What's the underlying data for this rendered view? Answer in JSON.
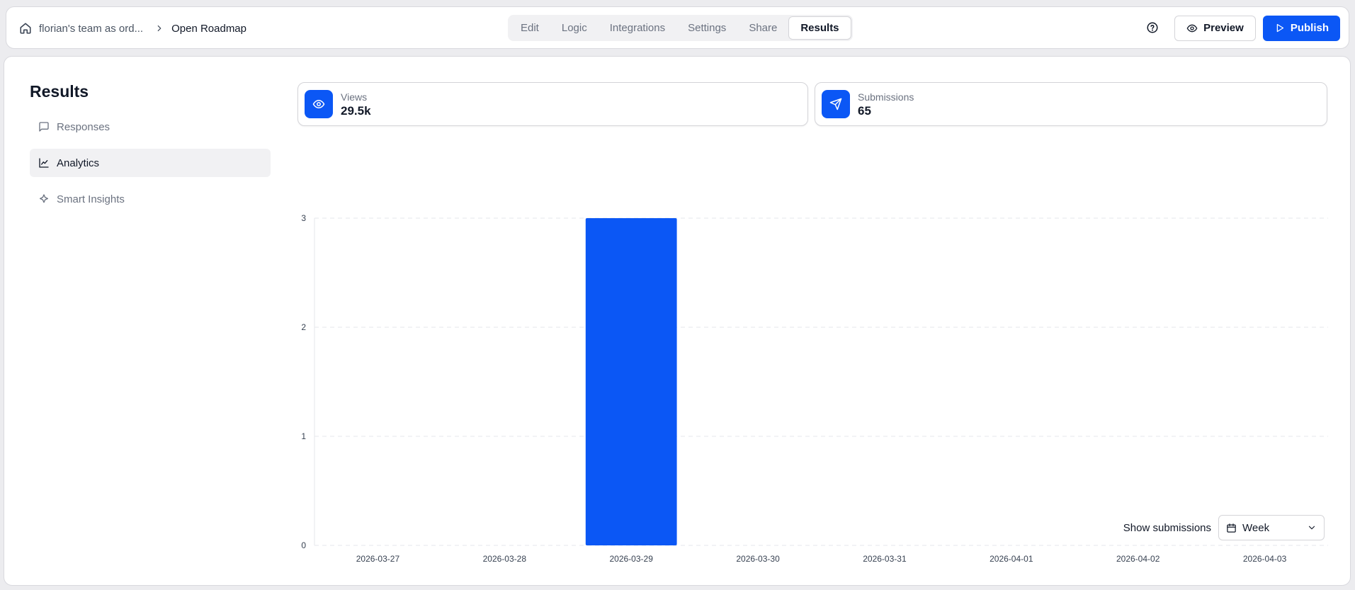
{
  "breadcrumb": {
    "team": "florian's team as ord...",
    "form": "Open Roadmap"
  },
  "tabs": [
    "Edit",
    "Logic",
    "Integrations",
    "Settings",
    "Share",
    "Results"
  ],
  "active_tab": "Results",
  "actions": {
    "preview": "Preview",
    "publish": "Publish"
  },
  "sidebar": {
    "title": "Results",
    "items": [
      {
        "label": "Responses",
        "icon": "message-square-icon",
        "active": false
      },
      {
        "label": "Analytics",
        "icon": "line-chart-icon",
        "active": true
      },
      {
        "label": "Smart Insights",
        "icon": "sparkle-icon",
        "active": false
      }
    ]
  },
  "stats": [
    {
      "label": "Views",
      "value": "29.5k",
      "icon": "eye-icon"
    },
    {
      "label": "Submissions",
      "value": "65",
      "icon": "send-icon"
    }
  ],
  "chart_data": {
    "type": "bar",
    "categories": [
      "2026-03-27",
      "2026-03-28",
      "2026-03-29",
      "2026-03-30",
      "2026-03-31",
      "2026-04-01",
      "2026-04-02",
      "2026-04-03"
    ],
    "values": [
      0,
      0,
      3,
      0,
      0,
      0,
      0,
      0
    ],
    "yticks": [
      0,
      1,
      2,
      3
    ],
    "ylim": [
      0,
      3
    ],
    "grid": true,
    "bar_color": "#0b57f5"
  },
  "controls": {
    "show_label": "Show submissions",
    "period": "Week"
  },
  "colors": {
    "accent": "#0b57f5"
  }
}
